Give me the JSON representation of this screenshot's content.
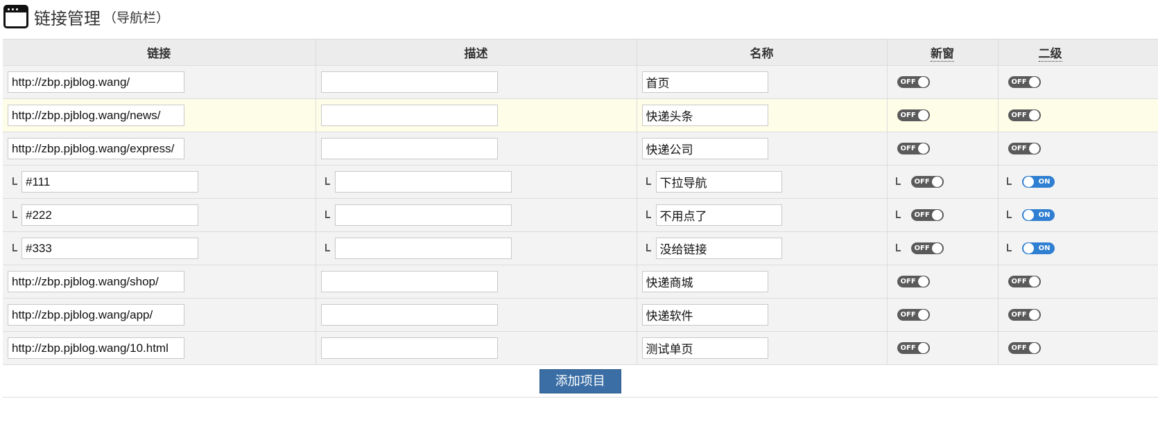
{
  "header": {
    "icon": "window-icon",
    "title": "链接管理",
    "subtitle": "（导航栏）"
  },
  "table": {
    "columns": [
      "链接",
      "描述",
      "名称",
      "新窗",
      "二级"
    ],
    "rows": [
      {
        "level": 1,
        "url": "http://zbp.pjblog.wang/",
        "desc": "",
        "name": "首页",
        "new_window": "OFF",
        "secondary": "OFF",
        "highlight": false
      },
      {
        "level": 1,
        "url": "http://zbp.pjblog.wang/news/",
        "desc": "",
        "name": "快递头条",
        "new_window": "OFF",
        "secondary": "OFF",
        "highlight": true
      },
      {
        "level": 1,
        "url": "http://zbp.pjblog.wang/express/",
        "desc": "",
        "name": "快递公司",
        "new_window": "OFF",
        "secondary": "OFF",
        "highlight": false
      },
      {
        "level": 2,
        "url": "#111",
        "desc": "",
        "name": "下拉导航",
        "new_window": "OFF",
        "secondary": "ON",
        "highlight": false
      },
      {
        "level": 2,
        "url": "#222",
        "desc": "",
        "name": "不用点了",
        "new_window": "OFF",
        "secondary": "ON",
        "highlight": false
      },
      {
        "level": 2,
        "url": "#333",
        "desc": "",
        "name": "没给链接",
        "new_window": "OFF",
        "secondary": "ON",
        "highlight": false
      },
      {
        "level": 1,
        "url": "http://zbp.pjblog.wang/shop/",
        "desc": "",
        "name": "快递商城",
        "new_window": "OFF",
        "secondary": "OFF",
        "highlight": false
      },
      {
        "level": 1,
        "url": "http://zbp.pjblog.wang/app/",
        "desc": "",
        "name": "快递软件",
        "new_window": "OFF",
        "secondary": "OFF",
        "highlight": false
      },
      {
        "level": 1,
        "url": "http://zbp.pjblog.wang/10.html",
        "desc": "",
        "name": "测试单页",
        "new_window": "OFF",
        "secondary": "OFF",
        "highlight": false
      }
    ]
  },
  "footer": {
    "add_button": "添加项目"
  },
  "colors": {
    "toggle_on": "#2f7fd2",
    "toggle_off": "#5a5a5a",
    "button": "#3a6ea5",
    "highlight_row": "#fefde7"
  }
}
